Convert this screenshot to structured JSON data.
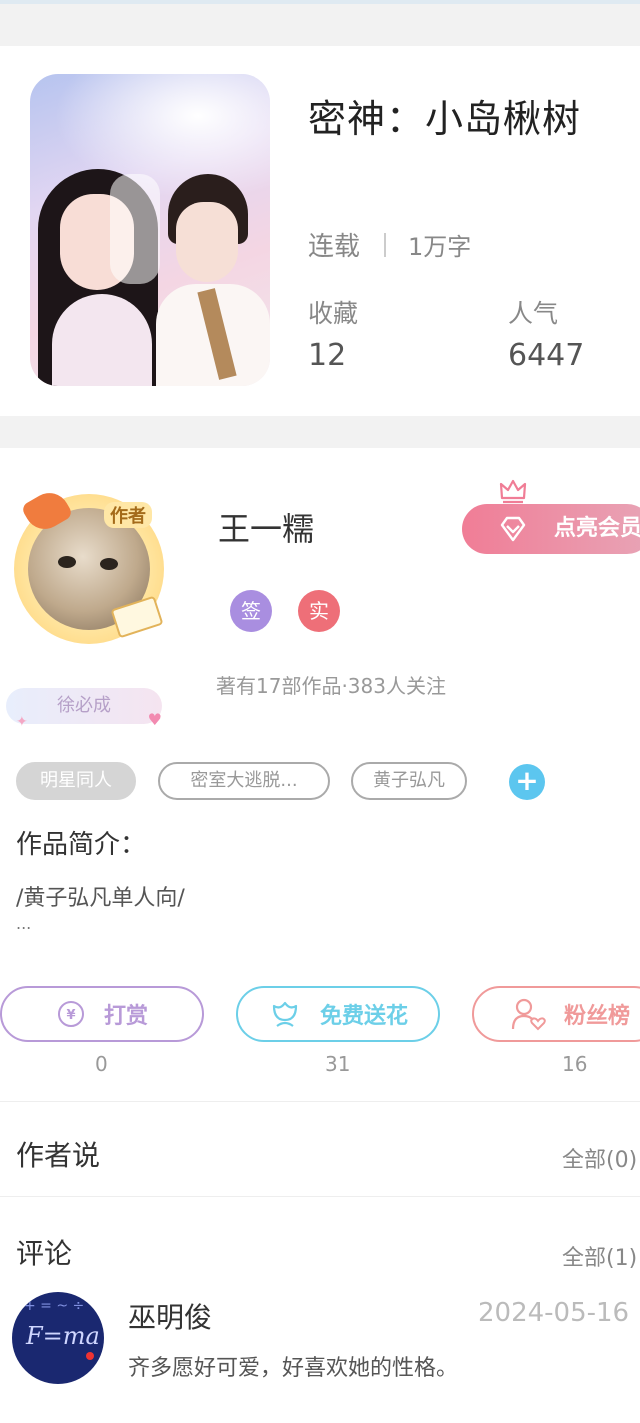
{
  "book": {
    "title": "密神：小岛楸树",
    "status": "连载",
    "word_count": "1万字",
    "favorites_label": "收藏",
    "favorites_value": "12",
    "popularity_label": "人气",
    "popularity_value": "6447"
  },
  "author": {
    "name": "王一糯",
    "avatar_badge": "作者",
    "fan_tag": "徐必成",
    "badges": [
      {
        "label": "签",
        "color": "#a98ee0"
      },
      {
        "label": "实",
        "color": "#ee6f78"
      }
    ],
    "stats": "著有17部作品·383人关注",
    "vip_button": "点亮会员"
  },
  "tags": [
    "明星同人",
    "密室大逃脱...",
    "黄子弘凡"
  ],
  "intro": {
    "title": "作品简介：",
    "text": "/黄子弘凡单人向/",
    "more": "..."
  },
  "actions": [
    {
      "label": "打赏",
      "count": "0",
      "color": "#b89ad8"
    },
    {
      "label": "免费送花",
      "count": "31",
      "color": "#6ccfe8"
    },
    {
      "label": "粉丝榜",
      "count": "16",
      "color": "#f09a9a"
    }
  ],
  "author_says": {
    "title": "作者说",
    "all": "全部(0)"
  },
  "comments": {
    "title": "评论",
    "all": "全部(1)",
    "items": [
      {
        "user": "巫明俊",
        "date": "2024-05-16",
        "text": "齐多愿好可爱，好喜欢她的性格。"
      }
    ]
  }
}
